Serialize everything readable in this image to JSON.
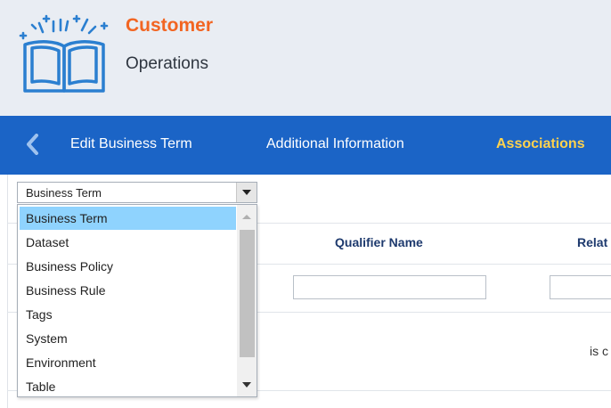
{
  "brand": {
    "title": "Customer",
    "subtitle": "Operations",
    "title_color": "#f26522"
  },
  "nav": {
    "back_icon": "chevron-left-icon",
    "tabs": [
      {
        "label": "Edit Business Term",
        "active": false
      },
      {
        "label": "Additional Information",
        "active": false
      },
      {
        "label": "Associations",
        "active": true
      }
    ],
    "bar_color": "#1b64c6",
    "active_color": "#ffd24d"
  },
  "type_select": {
    "value": "Business Term",
    "options": [
      {
        "label": "Business Term",
        "selected": true
      },
      {
        "label": "Dataset",
        "selected": false
      },
      {
        "label": "Business Policy",
        "selected": false
      },
      {
        "label": "Business Rule",
        "selected": false
      },
      {
        "label": "Tags",
        "selected": false
      },
      {
        "label": "System",
        "selected": false
      },
      {
        "label": "Environment",
        "selected": false
      },
      {
        "label": "Table",
        "selected": false
      }
    ],
    "highlight_color": "#8fd3fe"
  },
  "table": {
    "columns": [
      "Qualifier Name",
      "Relat"
    ],
    "empty_message_fragment": "is c"
  }
}
